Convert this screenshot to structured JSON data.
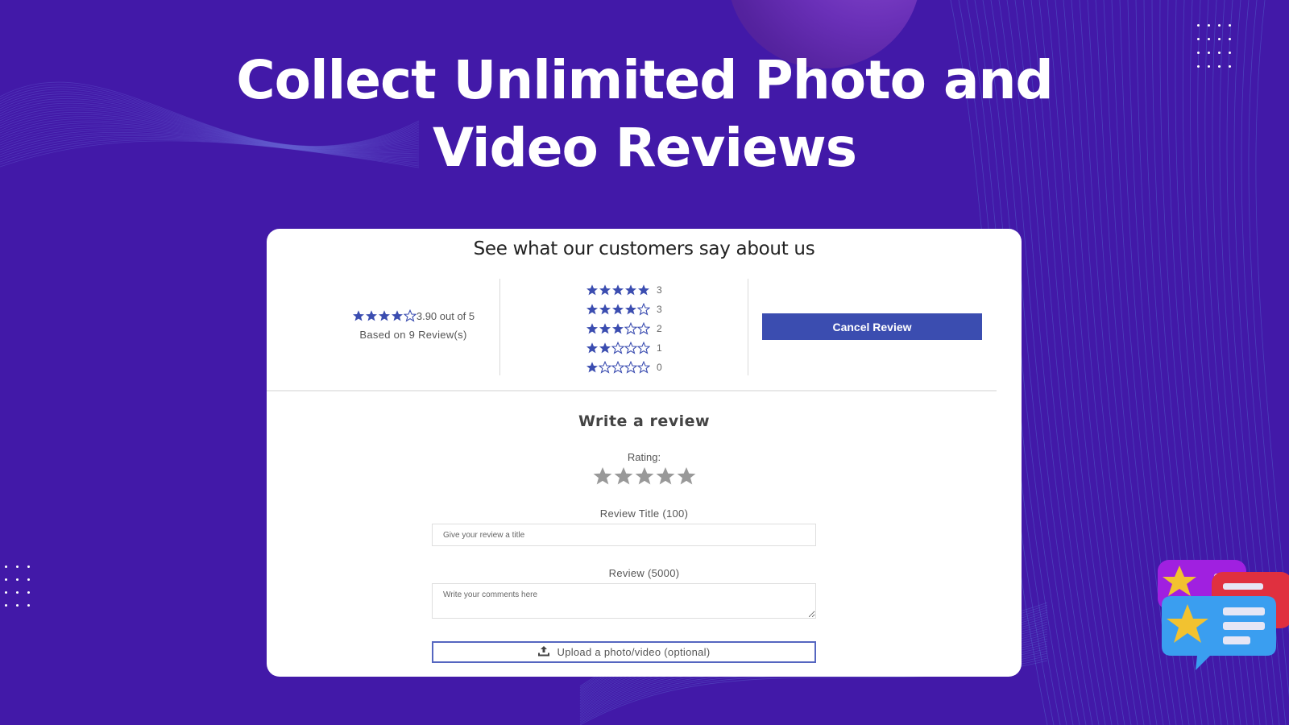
{
  "headline": {
    "line1": "Collect Unlimited Photo and",
    "line2": "Video Reviews"
  },
  "colors": {
    "background": "#4219a8",
    "accent": "#3b4db0",
    "star_filled": "#3b4db0",
    "rating_star": "#999999"
  },
  "widget": {
    "title": "See what our customers say about us",
    "summary": {
      "average_text": "3.90 out of 5",
      "average": 3.9,
      "filled_stars": 4,
      "based_on": "Based on 9 Review(s)"
    },
    "breakdown": [
      {
        "stars": 5,
        "count": "3"
      },
      {
        "stars": 4,
        "count": "3"
      },
      {
        "stars": 3,
        "count": "2"
      },
      {
        "stars": 2,
        "count": "1"
      },
      {
        "stars": 1,
        "count": "0"
      }
    ],
    "cancel_button": "Cancel Review",
    "form": {
      "heading": "Write a review",
      "rating_label": "Rating:",
      "title_label": "Review Title (100)",
      "title_placeholder": "Give your review a title",
      "title_value": "",
      "review_label": "Review (5000)",
      "review_placeholder": "Write your comments here",
      "review_value": "",
      "upload_label": "Upload a photo/video (optional)"
    }
  },
  "icons": {
    "star_filled": "star-filled-icon",
    "star_empty": "star-outline-icon",
    "upload": "upload-icon",
    "illustration": "review-chat-bubbles-illustration"
  }
}
